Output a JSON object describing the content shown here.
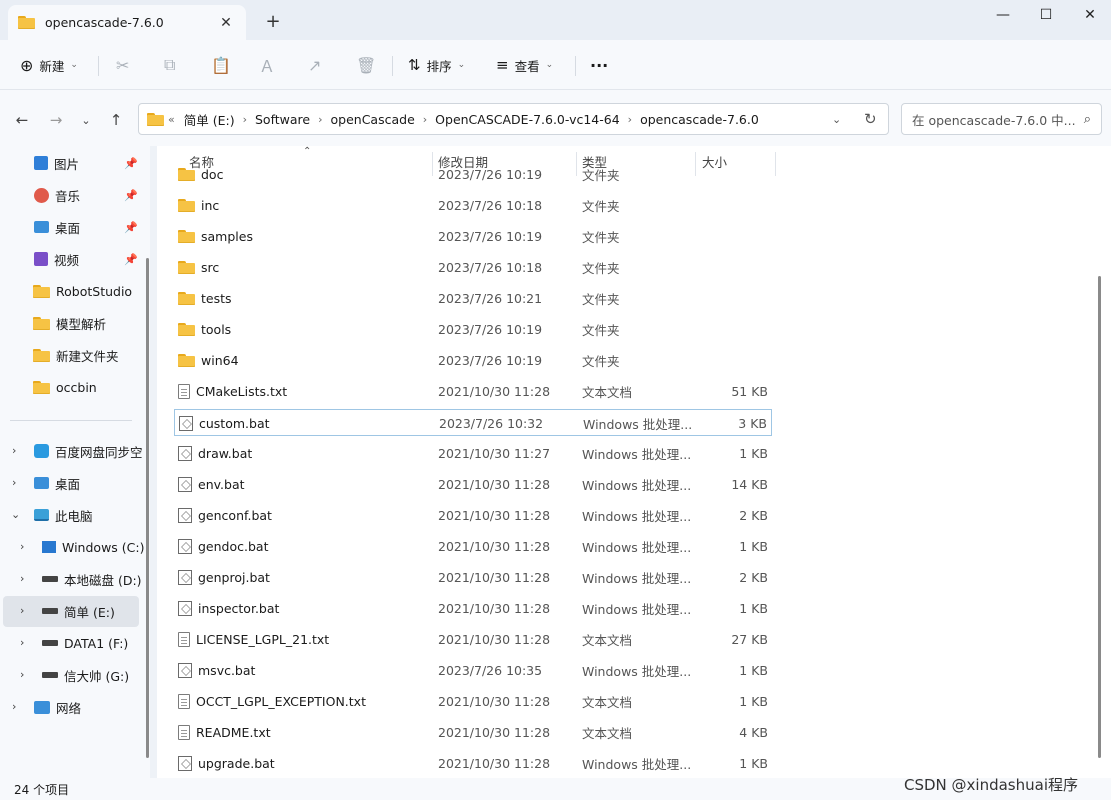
{
  "tab": {
    "title": "opencascade-7.6.0",
    "close": "✕",
    "new": "+"
  },
  "window": {
    "min": "—",
    "max": "☐",
    "close": "✕"
  },
  "toolbar": {
    "new_label": "新建",
    "new_icon": "⊕",
    "caret": "⌄",
    "sort_label": "排序",
    "sort_icon": "⇅",
    "view_label": "查看",
    "view_icon": "≡",
    "more": "···",
    "cut": "✂",
    "copy": "⧉",
    "paste": "📋",
    "rename": "Ａ",
    "share": "↗",
    "delete": "🗑"
  },
  "nav": {
    "back": "←",
    "forward": "→",
    "down": "⌄",
    "up": "↑"
  },
  "address": {
    "overflow": "«",
    "crumbs": [
      "简单 (E:)",
      "Software",
      "openCascade",
      "OpenCASCADE-7.6.0-vc14-64",
      "opencascade-7.6.0"
    ],
    "sep": "›",
    "dropdown": "⌄",
    "refresh": "↻"
  },
  "search": {
    "placeholder": "在 opencascade-7.6.0 中...",
    "icon": "⌕"
  },
  "sidebar": {
    "quick": [
      {
        "label": "图片",
        "icon": "image-icon",
        "pinned": true
      },
      {
        "label": "音乐",
        "icon": "music-icon",
        "pinned": true
      },
      {
        "label": "桌面",
        "icon": "desktop-icon",
        "pinned": true
      },
      {
        "label": "视频",
        "icon": "video-icon",
        "pinned": true
      },
      {
        "label": "RobotStudio",
        "icon": "folder-icon",
        "pinned": false
      },
      {
        "label": "模型解析",
        "icon": "folder-icon",
        "pinned": false
      },
      {
        "label": "新建文件夹",
        "icon": "folder-icon",
        "pinned": false
      },
      {
        "label": "occbin",
        "icon": "folder-icon",
        "pinned": false
      }
    ],
    "pin_glyph": "📌",
    "tree": [
      {
        "label": "百度网盘同步空",
        "icon": "cloud-icon",
        "expander": "›"
      },
      {
        "label": "桌面",
        "icon": "desktop-icon",
        "expander": "›"
      },
      {
        "label": "此电脑",
        "icon": "pc-icon",
        "expander": "⌄"
      },
      {
        "label": "Windows (C:)",
        "icon": "windows-drive-icon",
        "expander": "›"
      },
      {
        "label": "本地磁盘 (D:)",
        "icon": "drive-icon",
        "expander": "›"
      },
      {
        "label": "简单 (E:)",
        "icon": "drive-icon",
        "expander": "›"
      },
      {
        "label": "DATA1 (F:)",
        "icon": "drive-icon",
        "expander": "›"
      },
      {
        "label": "信大帅 (G:)",
        "icon": "drive-icon",
        "expander": "›"
      },
      {
        "label": "网络",
        "icon": "network-icon",
        "expander": "›"
      }
    ]
  },
  "columns": {
    "name": "名称",
    "date": "修改日期",
    "type": "类型",
    "size": "大小",
    "sort": "⌃"
  },
  "files": [
    {
      "name": "doc",
      "date": "2023/7/26 10:19",
      "type": "文件夹",
      "size": "",
      "kind": "folder"
    },
    {
      "name": "inc",
      "date": "2023/7/26 10:18",
      "type": "文件夹",
      "size": "",
      "kind": "folder"
    },
    {
      "name": "samples",
      "date": "2023/7/26 10:19",
      "type": "文件夹",
      "size": "",
      "kind": "folder"
    },
    {
      "name": "src",
      "date": "2023/7/26 10:18",
      "type": "文件夹",
      "size": "",
      "kind": "folder"
    },
    {
      "name": "tests",
      "date": "2023/7/26 10:21",
      "type": "文件夹",
      "size": "",
      "kind": "folder"
    },
    {
      "name": "tools",
      "date": "2023/7/26 10:19",
      "type": "文件夹",
      "size": "",
      "kind": "folder"
    },
    {
      "name": "win64",
      "date": "2023/7/26 10:19",
      "type": "文件夹",
      "size": "",
      "kind": "folder"
    },
    {
      "name": "CMakeLists.txt",
      "date": "2021/10/30 11:28",
      "type": "文本文档",
      "size": "51 KB",
      "kind": "text"
    },
    {
      "name": "custom.bat",
      "date": "2023/7/26 10:32",
      "type": "Windows 批处理...",
      "size": "3 KB",
      "kind": "bat",
      "selected": true
    },
    {
      "name": "draw.bat",
      "date": "2021/10/30 11:27",
      "type": "Windows 批处理...",
      "size": "1 KB",
      "kind": "bat"
    },
    {
      "name": "env.bat",
      "date": "2021/10/30 11:28",
      "type": "Windows 批处理...",
      "size": "14 KB",
      "kind": "bat"
    },
    {
      "name": "genconf.bat",
      "date": "2021/10/30 11:28",
      "type": "Windows 批处理...",
      "size": "2 KB",
      "kind": "bat"
    },
    {
      "name": "gendoc.bat",
      "date": "2021/10/30 11:28",
      "type": "Windows 批处理...",
      "size": "1 KB",
      "kind": "bat"
    },
    {
      "name": "genproj.bat",
      "date": "2021/10/30 11:28",
      "type": "Windows 批处理...",
      "size": "2 KB",
      "kind": "bat"
    },
    {
      "name": "inspector.bat",
      "date": "2021/10/30 11:28",
      "type": "Windows 批处理...",
      "size": "1 KB",
      "kind": "bat"
    },
    {
      "name": "LICENSE_LGPL_21.txt",
      "date": "2021/10/30 11:28",
      "type": "文本文档",
      "size": "27 KB",
      "kind": "text"
    },
    {
      "name": "msvc.bat",
      "date": "2023/7/26 10:35",
      "type": "Windows 批处理...",
      "size": "1 KB",
      "kind": "bat"
    },
    {
      "name": "OCCT_LGPL_EXCEPTION.txt",
      "date": "2021/10/30 11:28",
      "type": "文本文档",
      "size": "1 KB",
      "kind": "text"
    },
    {
      "name": "README.txt",
      "date": "2021/10/30 11:28",
      "type": "文本文档",
      "size": "4 KB",
      "kind": "text"
    },
    {
      "name": "upgrade.bat",
      "date": "2021/10/30 11:28",
      "type": "Windows 批处理...",
      "size": "1 KB",
      "kind": "bat"
    }
  ],
  "status": {
    "count": "24 个项目"
  },
  "watermark": "CSDN @xindashuai程序"
}
